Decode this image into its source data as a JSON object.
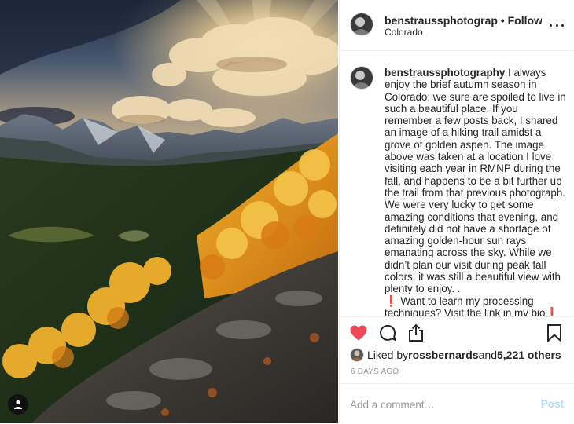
{
  "post": {
    "photo_alt": "autumn aspen valley in Rocky Mountain National Park",
    "user_tag_icon": "person-icon"
  },
  "header": {
    "username": "benstraussphotograp",
    "separator": " • ",
    "follow_status": "Following",
    "location": "Colorado",
    "more_icon": "ellipsis-icon"
  },
  "caption": {
    "username": "benstraussphotography",
    "text": " I always enjoy the brief autumn season in Colorado; we sure are spoiled to live in such a beautiful place. If you remember a few posts back, I shared an image of a hiking trail amidst a grove of golden aspen. The image above was taken at a location I love visiting each year in RMNP during the fall, and happens to be a bit further up the trail from that previous photograph. We were very lucky to get some amazing conditions that evening, and definitely did not have a shortage of amazing golden-hour sun rays emanating across the sky. While we didn’t plan our visit during peak fall colors, it was still a beautiful view with plenty to enjoy. .",
    "cta_mark": "❗",
    "cta_text": " Want to learn my processing techniques? Visit the link in my bio"
  },
  "actions": {
    "like_icon": "heart-filled-icon",
    "comment_icon": "comment-icon",
    "share_icon": "share-icon",
    "save_icon": "bookmark-icon",
    "like_color": "#ed4956"
  },
  "likes": {
    "prefix": "Liked by ",
    "user": "rossbernards",
    "joiner": " and ",
    "others": "5,221 others"
  },
  "timestamp": "6 DAYS AGO",
  "comment": {
    "placeholder": "Add a comment…",
    "post_label": "Post"
  }
}
